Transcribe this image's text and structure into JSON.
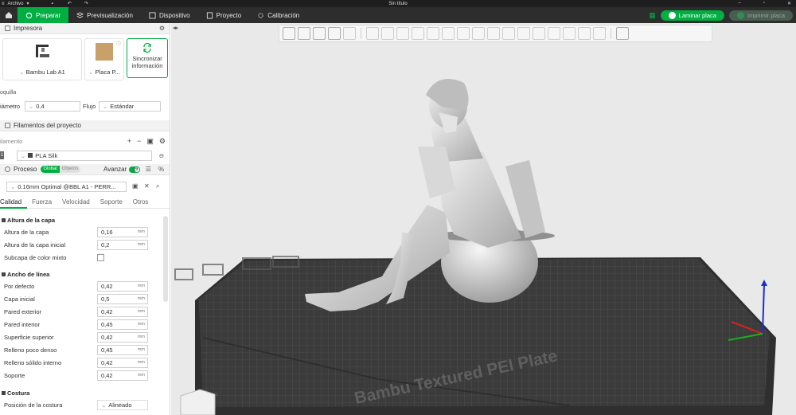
{
  "titlebar": {
    "menu_label": "Archivo",
    "window_title": "Sin título"
  },
  "nav": {
    "tabs": [
      {
        "label": "Preparar",
        "icon": "prepare-icon"
      },
      {
        "label": "Previsualización",
        "icon": "preview-icon"
      },
      {
        "label": "Dispositivo",
        "icon": "device-icon"
      },
      {
        "label": "Proyecto",
        "icon": "project-icon"
      },
      {
        "label": "Calibración",
        "icon": "calibration-icon"
      }
    ],
    "slice_label": "Laminar placa",
    "print_label": "Imprimir placa"
  },
  "printer": {
    "header": "Impresora",
    "printer_name": "Bambu Lab A1",
    "plate_name": "Placa P...",
    "sync_label": "Sincronizar información",
    "nozzle_section": "oquilla",
    "diameter_label": "iámetro",
    "diameter_value": "0.4",
    "flow_label": "Flujo",
    "flow_value": "Estándar"
  },
  "filaments": {
    "header": "Filamentos del proyecto",
    "column_label": "ilamento",
    "items": [
      {
        "index": "1",
        "name": "PLA Silk"
      }
    ]
  },
  "process": {
    "header": "Proceso",
    "scope_global": "Global",
    "scope_objects": "Objetos",
    "advanced_label": "Avanzar",
    "preset": "0.16mm Optimal @BBL A1 - PERR...",
    "tabs": [
      "Calidad",
      "Fuerza",
      "Velocidad",
      "Soporte",
      "Otros"
    ],
    "groups": [
      {
        "title": "Altura de la capa",
        "rows": [
          {
            "name": "Altura de la capa",
            "value": "0,16",
            "unit": "mm"
          },
          {
            "name": "Altura de la capa inicial",
            "value": "0,2",
            "unit": "mm"
          },
          {
            "name": "Subcapa de color mixto",
            "value": null,
            "unit": ""
          }
        ]
      },
      {
        "title": "Ancho de línea",
        "rows": [
          {
            "name": "Por defecto",
            "value": "0,42",
            "unit": "mm"
          },
          {
            "name": "Capa inicial",
            "value": "0,5",
            "unit": "mm"
          },
          {
            "name": "Pared exterior",
            "value": "0,42",
            "unit": "mm"
          },
          {
            "name": "Pared interior",
            "value": "0,45",
            "unit": "mm"
          },
          {
            "name": "Superficie superior",
            "value": "0,42",
            "unit": "mm"
          },
          {
            "name": "Relleno poco denso",
            "value": "0,45",
            "unit": "mm"
          },
          {
            "name": "Relleno sólido interno",
            "value": "0,42",
            "unit": "mm"
          },
          {
            "name": "Soporte",
            "value": "0,42",
            "unit": "mm"
          }
        ]
      },
      {
        "title": "Costura",
        "rows": [
          {
            "name": "Posición de la costura",
            "value": "Alineado",
            "unit": ""
          }
        ]
      }
    ]
  },
  "viewport": {
    "plate_label": "Bambu Textured PEI Plate",
    "axis_colors": {
      "x": "#e0201e",
      "y": "#18b018",
      "z": "#1c2fd0"
    },
    "accent": "#00ae42"
  }
}
